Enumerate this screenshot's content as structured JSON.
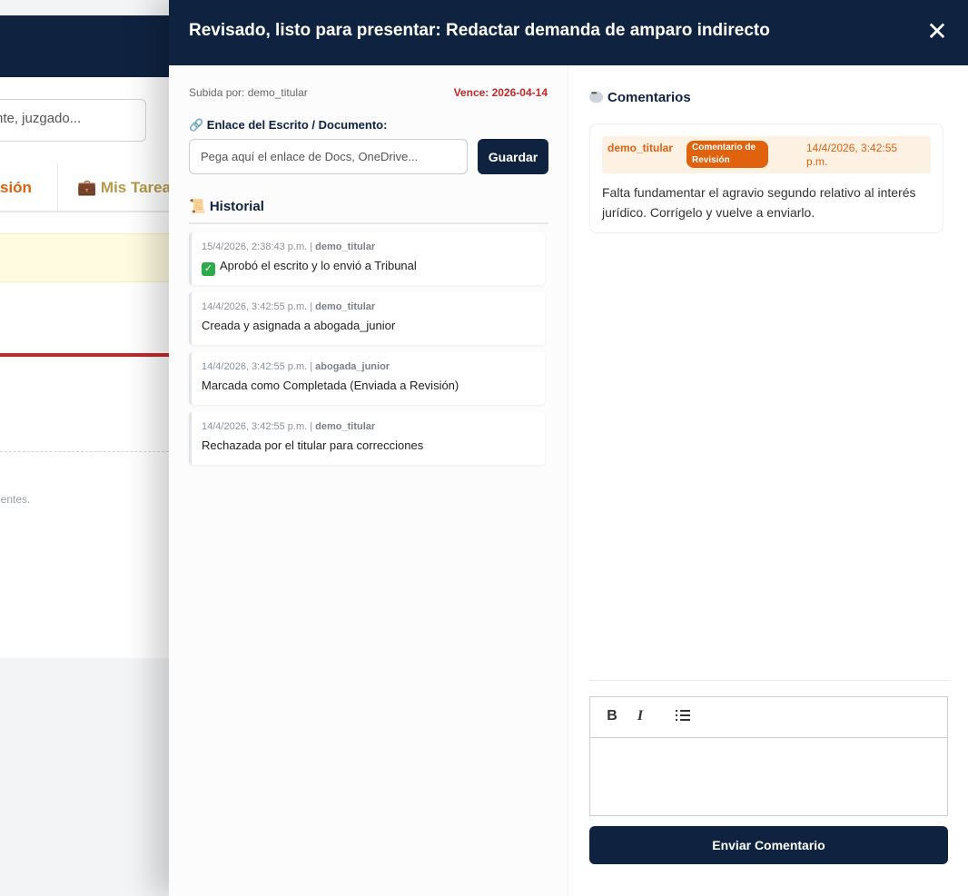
{
  "background": {
    "search_text": "nte, juzgado...",
    "tab_partial_1": "sión",
    "tab_partial_2": "Mis Tarea",
    "note_partial": "ientes."
  },
  "drawer": {
    "title": "Revisado, listo para presentar: Redactar demanda de amparo indirecto",
    "close_symbol": "✕",
    "uploaded_by": "Subida por: demo_titular",
    "due_date": "Vence: 2026-04-14",
    "link_label": "🔗 Enlace del Escrito / Documento:",
    "link_placeholder": "Pega aquí el enlace de Docs, OneDrive...",
    "save_label": "Guardar",
    "history_title": "📜 Historial",
    "history": [
      {
        "date": "15/4/2026, 2:38:43 p.m. | ",
        "user": "demo_titular",
        "text": "Aprobó el escrito y lo envió a Tribunal",
        "check": "✓"
      },
      {
        "date": "14/4/2026, 3:42:55 p.m. | ",
        "user": "demo_titular",
        "text": "Creada y asignada a abogada_junior"
      },
      {
        "date": "14/4/2026, 3:42:55 p.m. | ",
        "user": "abogada_junior",
        "text": "Marcada como Completada (Enviada a Revisión)"
      },
      {
        "date": "14/4/2026, 3:42:55 p.m. | ",
        "user": "demo_titular",
        "text": "Rechazada por el titular para correcciones"
      }
    ],
    "comments_title": "Comentarios",
    "comments": [
      {
        "author": "demo_titular",
        "badge": "Comentario de Revisión",
        "date": "14/4/2026, 3:42:55 p.m.",
        "body": "Falta fundamentar el agravio segundo relativo al interés jurídico. Corrígelo y vuelve a enviarlo."
      }
    ],
    "toolbar": {
      "bold": "B",
      "italic": "I"
    },
    "send_label": "Enviar Comentario"
  },
  "colors": {
    "navy": "#0f2341",
    "accent_orange": "#e0610e",
    "due_red": "#c62828"
  }
}
